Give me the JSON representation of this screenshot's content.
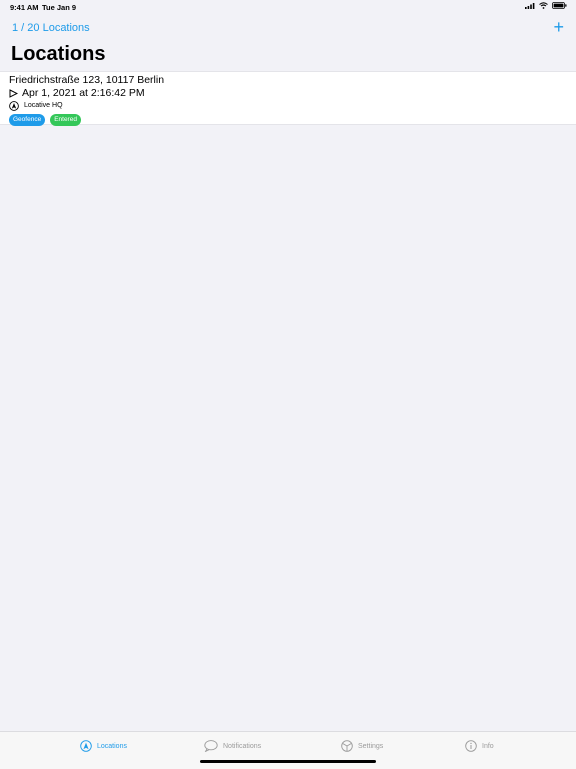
{
  "status_bar": {
    "time": "9:41 AM",
    "date": "Tue Jan 9"
  },
  "nav": {
    "back_label": "1 / 20 Locations",
    "add_label": "+",
    "title": "Locations"
  },
  "locations": [
    {
      "address": "Friedrichstraße 123, 10117 Berlin",
      "datetime": "Apr 1, 2021 at 2:16:42 PM",
      "geofence": "Locative HQ",
      "badges": [
        "Geofence",
        "Entered"
      ]
    }
  ],
  "tabs": [
    {
      "label": "Locations",
      "icon": "location-arrow-icon",
      "active": true
    },
    {
      "label": "Notifications",
      "icon": "speech-bubble-icon",
      "active": false
    },
    {
      "label": "Settings",
      "icon": "settings-icon",
      "active": false
    },
    {
      "label": "Info",
      "icon": "info-icon",
      "active": false
    }
  ],
  "colors": {
    "accent": "#1e9be9",
    "badge_geofence": "#1e9be9",
    "badge_entered": "#34c759",
    "inactive": "#9b9b9b"
  }
}
